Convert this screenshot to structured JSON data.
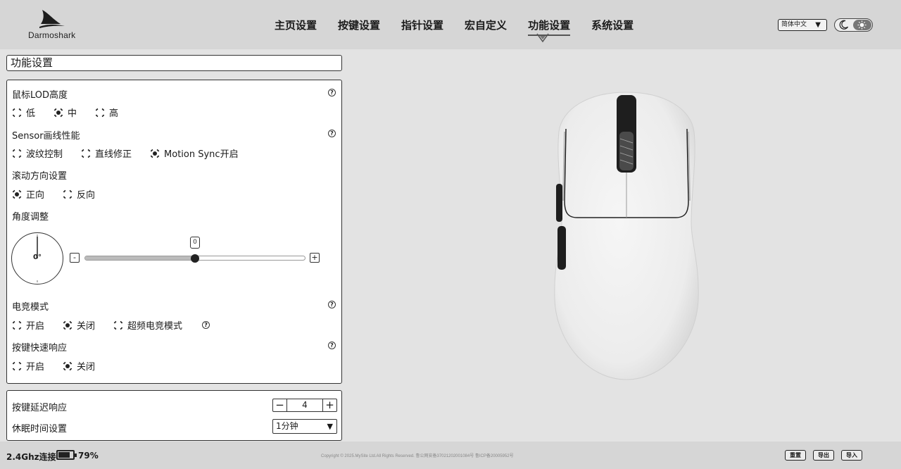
{
  "header": {
    "logo_text": "Darmoshark",
    "nav": [
      {
        "label": "主页设置"
      },
      {
        "label": "按键设置"
      },
      {
        "label": "指针设置"
      },
      {
        "label": "宏自定义"
      },
      {
        "label": "功能设置",
        "active": true
      },
      {
        "label": "系统设置"
      }
    ],
    "language": "简体中文",
    "theme": "light"
  },
  "page_title": "功能设置",
  "settings": {
    "lod": {
      "label": "鼠标LOD高度",
      "options": [
        "低",
        "中",
        "高"
      ],
      "selected": "中"
    },
    "sensor": {
      "label": "Sensor画线性能",
      "options": [
        "波纹控制",
        "直线修正",
        "Motion Sync开启"
      ],
      "selected": [
        "Motion Sync开启"
      ]
    },
    "scroll": {
      "label": "滚动方向设置",
      "options": [
        "正向",
        "反向"
      ],
      "selected": "正向"
    },
    "angle": {
      "label": "角度调整",
      "dial_value": "0°",
      "slider_value": "0",
      "minus": "-",
      "plus": "+"
    },
    "esports": {
      "label": "电竞模式",
      "options": [
        "开启",
        "关闭",
        "超频电竞模式"
      ],
      "selected": "关闭"
    },
    "quick_response": {
      "label": "按键快速响应",
      "options": [
        "开启",
        "关闭"
      ],
      "selected": "关闭"
    },
    "key_delay": {
      "label": "按键延迟响应",
      "value": "4",
      "minus": "−",
      "plus": "+"
    },
    "sleep": {
      "label": "休眠时间设置",
      "value": "1分钟"
    }
  },
  "footer": {
    "connection": "2.4Ghz连接",
    "battery_percent": 79,
    "battery_label": "79%",
    "copyright": "Copyright © 2025.MySite Ltd.All Rights Reserved. 鲁公网安备37021202001084号 鲁ICP备20005952号",
    "buttons": [
      "重置",
      "导出",
      "导入"
    ]
  },
  "colors": {
    "background": "#e3e3e3",
    "header": "#d6d6d6",
    "panel": "#ffffff",
    "accent": "#222222"
  }
}
